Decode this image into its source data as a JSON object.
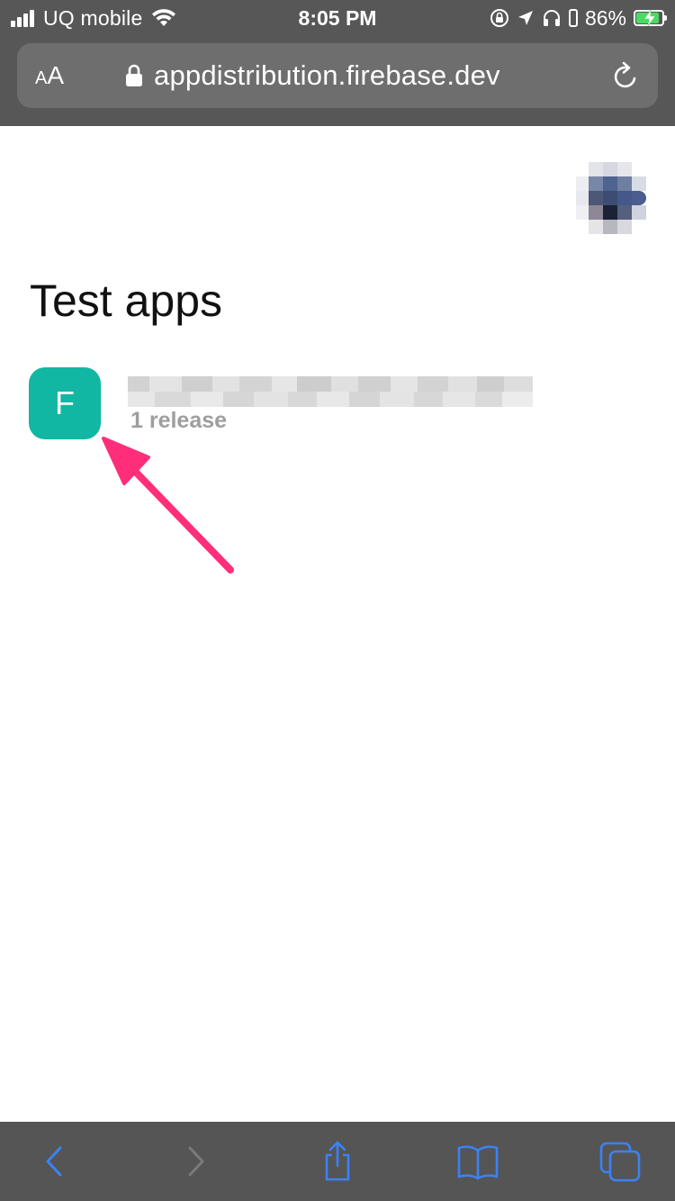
{
  "status_bar": {
    "carrier": "UQ mobile",
    "time": "8:05 PM",
    "battery_percent": "86%",
    "icons": [
      "signal-icon",
      "wifi-icon",
      "orientation-lock-icon",
      "location-icon",
      "headphones-icon",
      "battery-icon"
    ]
  },
  "browser": {
    "text_size_label_small": "A",
    "text_size_label_big": "A",
    "url": "appdistribution.firebase.dev"
  },
  "page": {
    "title": "Test apps",
    "apps": [
      {
        "initial": "F",
        "release_count": "1 release",
        "icon_color": "#11b7a2"
      }
    ]
  },
  "toolbar": {
    "buttons": [
      "back-icon",
      "forward-icon",
      "share-icon",
      "bookmarks-icon",
      "tabs-icon"
    ],
    "accent": "#3b82f6"
  },
  "annotation": {
    "arrow_color": "#ff2e7a"
  }
}
